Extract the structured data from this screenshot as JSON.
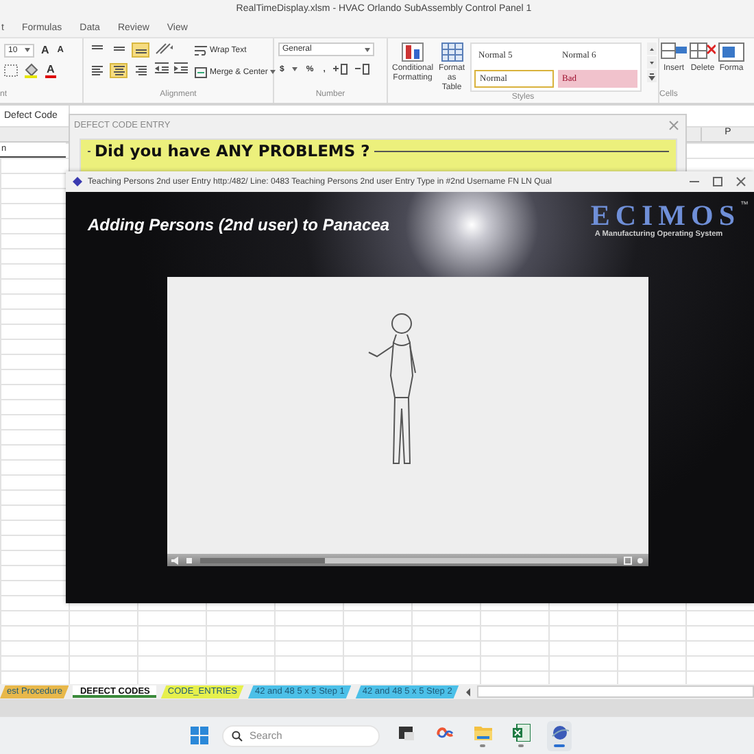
{
  "excel": {
    "title": "RealTimeDisplay.xlsm - HVAC Orlando SubAssembly Control Panel 1",
    "menu_tabs": [
      {
        "label": "t"
      },
      {
        "label": "Formulas"
      },
      {
        "label": "Data"
      },
      {
        "label": "Review"
      },
      {
        "label": "View"
      }
    ],
    "ribbon": {
      "font": {
        "size": "10",
        "grow": "A",
        "shrink": "A",
        "font_color": "A",
        "label": "nt"
      },
      "alignment": {
        "buttons": [
          {
            "selected": false
          },
          {
            "selected": false
          },
          {
            "selected": true
          },
          {
            "selected": false
          },
          {
            "selected": true
          },
          {
            "selected": false
          }
        ],
        "wrap_text": "Wrap Text",
        "merge": "Merge & Center",
        "label": "Alignment"
      },
      "number": {
        "format": "General",
        "currency": "$",
        "percent": "%",
        "comma": ",",
        "label": "Number"
      },
      "styles": {
        "conditional": "Conditional Formatting",
        "format_table": "Format as Table",
        "gallery": [
          {
            "label": "Normal 5",
            "kind": "plain"
          },
          {
            "label": "Normal 6",
            "kind": "plain"
          },
          {
            "label": "Normal",
            "kind": "current"
          },
          {
            "label": "Bad",
            "kind": "bad"
          }
        ],
        "label": "Styles"
      },
      "cells": {
        "buttons": [
          {
            "label": "Insert",
            "kind": "insert"
          },
          {
            "label": "Delete",
            "kind": "delete"
          },
          {
            "label": "Forma",
            "kind": "format"
          }
        ],
        "label": "Cells"
      }
    },
    "name_box": "Defect Code",
    "grid": {
      "column_header": "P",
      "cell": "n"
    },
    "sheet_tabs": [
      {
        "label": "est Procedure",
        "color": "#e8b84a",
        "selected": false
      },
      {
        "label": "DEFECT CODES",
        "color": "#ffffff",
        "selected": true
      },
      {
        "label": "CODE_ENTRIES",
        "color": "#e6f04c",
        "selected": false
      },
      {
        "label": "42 and 48 5 x 5 Step 1",
        "color": "#4cc0e8",
        "selected": false
      },
      {
        "label": "42 and 48 5 x 5 Step 2",
        "color": "#4cc0e8",
        "selected": false
      }
    ]
  },
  "dialog": {
    "title": "DEFECT CODE ENTRY",
    "question": "Did you have ANY PROBLEMS ?"
  },
  "video_window": {
    "title": "Teaching Persons 2nd user Entry http:/482/ Line: 0483 Teaching Persons 2nd user Entry Type in #2nd Username FN LN Qual",
    "heading": "Adding Persons (2nd user) to Panacea",
    "logo": "ECIMOS",
    "trademark": "™",
    "tagline": "A Manufacturing Operating System",
    "player": {
      "level": 0.3
    }
  },
  "taskbar": {
    "search_placeholder": "Search",
    "apps": [
      {
        "kind": "task-view",
        "running": false,
        "selected": false
      },
      {
        "kind": "app",
        "running": false,
        "selected": false
      },
      {
        "kind": "folder",
        "running": true,
        "selected": false
      },
      {
        "kind": "excel",
        "running": true,
        "selected": false
      },
      {
        "kind": "ecimos",
        "running": true,
        "selected": true
      }
    ]
  }
}
